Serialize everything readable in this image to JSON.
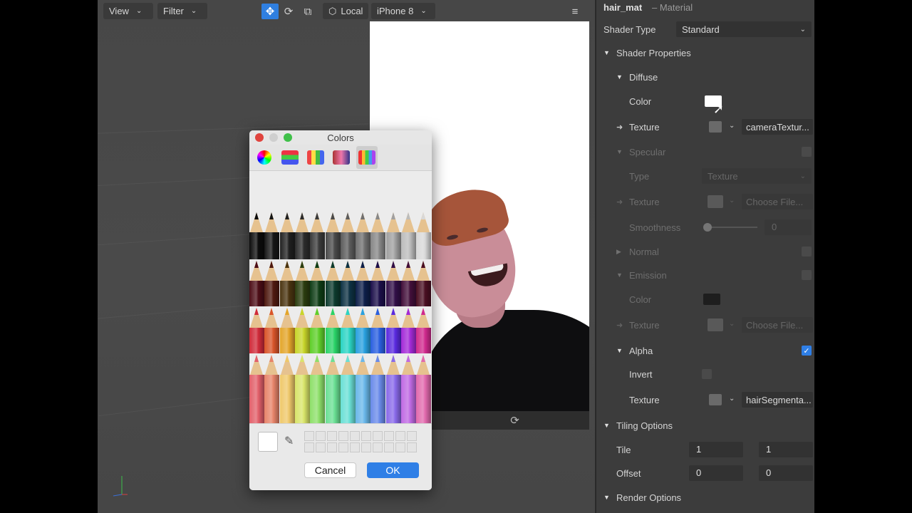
{
  "viewport": {
    "view_label": "View",
    "filter_label": "Filter",
    "local_label": "Local",
    "device_label": "iPhone 8",
    "tools": [
      "move-icon",
      "rotate-icon",
      "scale-icon"
    ],
    "colors": {
      "accent": "#2f7fe0",
      "background": "#474747"
    }
  },
  "colors_dialog": {
    "title": "Colors",
    "tabs": [
      "color-wheel-icon",
      "color-sliders-icon",
      "color-palettes-icon",
      "image-palettes-icon",
      "pencils-icon"
    ],
    "cancel_label": "Cancel",
    "ok_label": "OK",
    "current_color": "#ffffff"
  },
  "inspector": {
    "object_name": "hair_mat",
    "object_type": "– Material",
    "shader_type_label": "Shader Type",
    "shader_type_value": "Standard",
    "shader_properties_label": "Shader Properties",
    "diffuse": {
      "label": "Diffuse",
      "color_label": "Color",
      "color_value": "#ffffff",
      "texture_label": "Texture",
      "texture_value": "cameraTextur..."
    },
    "specular": {
      "label": "Specular",
      "type_label": "Type",
      "type_value": "Texture",
      "texture_label": "Texture",
      "texture_value": "Choose File...",
      "smoothness_label": "Smoothness",
      "smoothness_value": "0"
    },
    "normal_label": "Normal",
    "emission": {
      "label": "Emission",
      "color_label": "Color",
      "texture_label": "Texture",
      "texture_value": "Choose File..."
    },
    "alpha": {
      "label": "Alpha",
      "invert_label": "Invert",
      "texture_label": "Texture",
      "texture_value": "hairSegmenta..."
    },
    "tiling": {
      "label": "Tiling Options",
      "tile_label": "Tile",
      "tile_x": "1",
      "tile_y": "1",
      "offset_label": "Offset",
      "offset_x": "0",
      "offset_y": "0"
    },
    "render_options_label": "Render Options"
  }
}
